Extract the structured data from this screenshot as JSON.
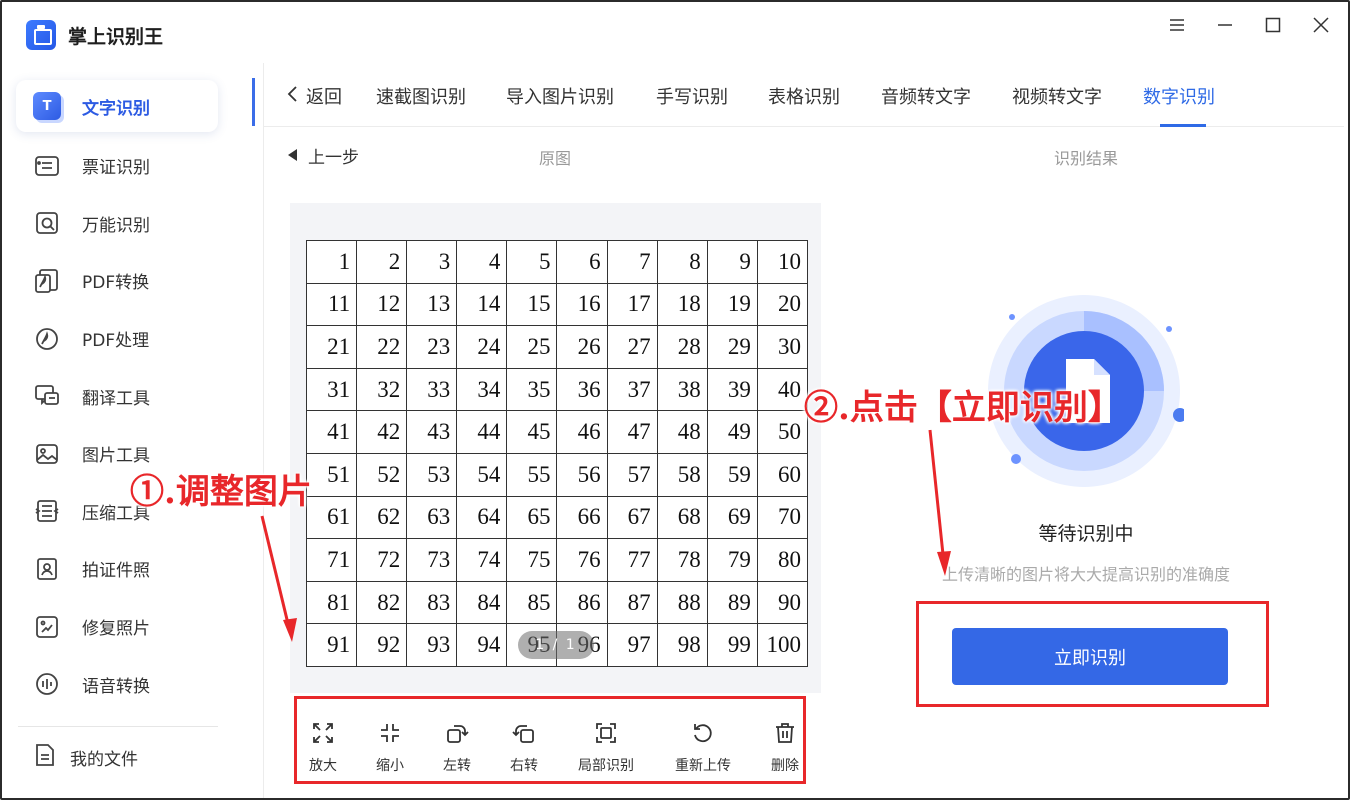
{
  "app": {
    "name": "掌上识别王",
    "accent": "#2f6ae6",
    "highlight": "#e8272a"
  },
  "sidebar": {
    "items": [
      {
        "label": "文字识别",
        "icon": "text-recognition-icon",
        "active": true
      },
      {
        "label": "票证识别",
        "icon": "ticket-icon"
      },
      {
        "label": "万能识别",
        "icon": "universal-scan-icon"
      },
      {
        "label": "PDF转换",
        "icon": "pdf-convert-icon"
      },
      {
        "label": "PDF处理",
        "icon": "pdf-process-icon"
      },
      {
        "label": "翻译工具",
        "icon": "translate-icon"
      },
      {
        "label": "图片工具",
        "icon": "image-tool-icon"
      },
      {
        "label": "压缩工具",
        "icon": "compress-icon"
      },
      {
        "label": "拍证件照",
        "icon": "id-photo-icon"
      },
      {
        "label": "修复照片",
        "icon": "repair-photo-icon"
      },
      {
        "label": "语音转换",
        "icon": "voice-convert-icon"
      }
    ],
    "my_files": "我的文件"
  },
  "tabs": {
    "back": "返回",
    "items": [
      "速截图识别",
      "导入图片识别",
      "手写识别",
      "表格识别",
      "音频转文字",
      "视频转文字",
      "数字识别"
    ],
    "active": "数字识别"
  },
  "subhead": {
    "prev_step": "上一步",
    "original": "原图",
    "result": "识别结果"
  },
  "preview": {
    "rows": [
      [
        "1",
        "2",
        "3",
        "4",
        "5",
        "6",
        "7",
        "8",
        "9",
        "10"
      ],
      [
        "11",
        "12",
        "13",
        "14",
        "15",
        "16",
        "17",
        "18",
        "19",
        "20"
      ],
      [
        "21",
        "22",
        "23",
        "24",
        "25",
        "26",
        "27",
        "28",
        "29",
        "30"
      ],
      [
        "31",
        "32",
        "33",
        "34",
        "35",
        "36",
        "37",
        "38",
        "39",
        "40"
      ],
      [
        "41",
        "42",
        "43",
        "44",
        "45",
        "46",
        "47",
        "48",
        "49",
        "50"
      ],
      [
        "51",
        "52",
        "53",
        "54",
        "55",
        "56",
        "57",
        "58",
        "59",
        "60"
      ],
      [
        "61",
        "62",
        "63",
        "64",
        "65",
        "66",
        "67",
        "68",
        "69",
        "70"
      ],
      [
        "71",
        "72",
        "73",
        "74",
        "75",
        "76",
        "77",
        "78",
        "79",
        "80"
      ],
      [
        "81",
        "82",
        "83",
        "84",
        "85",
        "86",
        "87",
        "88",
        "89",
        "90"
      ],
      [
        "91",
        "92",
        "93",
        "94",
        "95",
        "96",
        "97",
        "98",
        "99",
        "100"
      ]
    ],
    "pager": "1 / 1"
  },
  "toolbar": {
    "zoom_in": "放大",
    "zoom_out": "缩小",
    "rotate_left": "左转",
    "rotate_right": "右转",
    "partial": "局部识别",
    "reupload": "重新上传",
    "delete": "删除"
  },
  "result": {
    "status_title": "等待识别中",
    "status_hint": "上传清晰的图片将大大提高识别的准确度",
    "button": "立即识别"
  },
  "annotations": {
    "step1": "①.调整图片",
    "step2": "②.点击【立即识别】"
  }
}
